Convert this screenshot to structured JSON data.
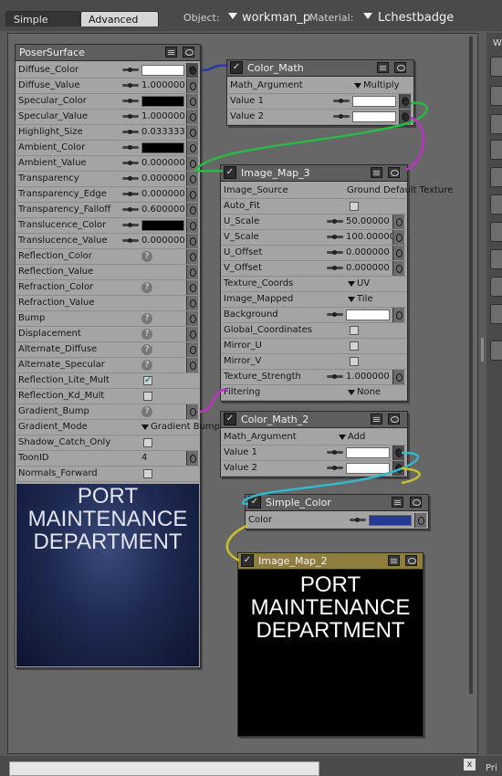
{
  "tabs": [
    "Simple",
    "Advanced"
  ],
  "object": {
    "label": "Object:",
    "value": "workman_p"
  },
  "material": {
    "label": "Material:",
    "value": "Lchestbadge"
  },
  "right_strip": {
    "label": "W"
  },
  "bottom": {
    "label": "Pri",
    "close": "x"
  },
  "colors": {
    "wire_blue": "#2a3aa0",
    "wire_green": "#2ab848",
    "wire_magenta": "#c030c8",
    "wire_cyan": "#34b8c8",
    "wire_yellow": "#c8c030",
    "simple_color_swatch": "#24389a"
  },
  "icons": {
    "node": "node-icon",
    "menu": "menu-icon",
    "eye": "eye-icon",
    "dial": "dial-icon",
    "plug": "input-plug-icon",
    "help": "help-icon",
    "checkbox": "checkbox-icon",
    "dropdown": "dropdown-arrow-icon"
  },
  "poser": {
    "title": "PoserSurface",
    "rows": {
      "diffuse_color": {
        "label": "Diffuse_Color",
        "swatch": "#ffffff"
      },
      "diffuse_value": {
        "label": "Diffuse_Value",
        "value": "1.000000"
      },
      "specular_color": {
        "label": "Specular_Color",
        "swatch": "#000000"
      },
      "specular_value": {
        "label": "Specular_Value",
        "value": "1.000000"
      },
      "highlight_size": {
        "label": "Highlight_Size",
        "value": "0.033333"
      },
      "ambient_color": {
        "label": "Ambient_Color",
        "swatch": "#000000"
      },
      "ambient_value": {
        "label": "Ambient_Value",
        "value": "0.000000"
      },
      "transparency": {
        "label": "Transparency",
        "value": "0.000000"
      },
      "transparency_edge": {
        "label": "Transparency_Edge",
        "value": "0.000000"
      },
      "transparency_falloff": {
        "label": "Transparency_Falloff",
        "value": "0.600000"
      },
      "translucence_color": {
        "label": "Translucence_Color",
        "swatch": "#000000"
      },
      "translucence_value": {
        "label": "Translucence_Value",
        "value": "0.000000"
      },
      "reflection_color": {
        "label": "Reflection_Color"
      },
      "reflection_value": {
        "label": "Reflection_Value"
      },
      "refraction_color": {
        "label": "Refraction_Color"
      },
      "refraction_value": {
        "label": "Refraction_Value"
      },
      "bump": {
        "label": "Bump"
      },
      "displacement": {
        "label": "Displacement"
      },
      "alternate_diffuse": {
        "label": "Alternate_Diffuse"
      },
      "alternate_specular": {
        "label": "Alternate_Specular"
      },
      "reflection_lite_mult": {
        "label": "Reflection_Lite_Mult",
        "checked": true
      },
      "reflection_kd_mult": {
        "label": "Reflection_Kd_Mult",
        "checked": false
      },
      "gradient_bump": {
        "label": "Gradient_Bump"
      },
      "gradient_mode": {
        "label": "Gradient_Mode",
        "value": "Gradient Bump"
      },
      "shadow_catch_only": {
        "label": "Shadow_Catch_Only",
        "checked": false
      },
      "toon_id": {
        "label": "ToonID",
        "value": "4"
      },
      "normals_forward": {
        "label": "Normals_Forward",
        "checked": false
      }
    },
    "preview_lines": [
      "PORT",
      "MAINTENANCE",
      "DEPARTMENT"
    ]
  },
  "color_math": {
    "title": "Color_Math",
    "math_argument": {
      "label": "Math_Argument",
      "value": "Multiply"
    },
    "value1": {
      "label": "Value 1",
      "swatch": "#ffffff"
    },
    "value2": {
      "label": "Value 2",
      "swatch": "#ffffff"
    }
  },
  "image_map_3": {
    "title": "Image_Map_3",
    "rows": {
      "image_source": {
        "label": "Image_Source",
        "value": "Ground Default Texture"
      },
      "auto_fit": {
        "label": "Auto_Fit",
        "checked": false
      },
      "u_scale": {
        "label": "U_Scale",
        "value": "50.00000"
      },
      "v_scale": {
        "label": "V_Scale",
        "value": "100.00000"
      },
      "u_offset": {
        "label": "U_Offset",
        "value": "0.000000"
      },
      "v_offset": {
        "label": "V_Offset",
        "value": "0.000000"
      },
      "texture_coords": {
        "label": "Texture_Coords",
        "value": "UV"
      },
      "image_mapped": {
        "label": "Image_Mapped",
        "value": "Tile"
      },
      "background": {
        "label": "Background",
        "swatch": "#ffffff"
      },
      "global_coordinates": {
        "label": "Global_Coordinates",
        "checked": false
      },
      "mirror_u": {
        "label": "Mirror_U",
        "checked": false
      },
      "mirror_v": {
        "label": "Mirror_V",
        "checked": false
      },
      "texture_strength": {
        "label": "Texture_Strength",
        "value": "1.000000"
      },
      "filtering": {
        "label": "Filtering",
        "value": "None"
      }
    }
  },
  "color_math_2": {
    "title": "Color_Math_2",
    "math_argument": {
      "label": "Math_Argument",
      "value": "Add"
    },
    "value1": {
      "label": "Value 1",
      "swatch": "#ffffff"
    },
    "value2": {
      "label": "Value 2",
      "swatch": "#ffffff"
    }
  },
  "simple_color": {
    "title": "Simple_Color",
    "color": {
      "label": "Color",
      "swatch": "#24389a"
    }
  },
  "image_map_2": {
    "title": "Image_Map_2",
    "preview_lines": [
      "PORT",
      "MAINTENANCE",
      "DEPARTMENT"
    ]
  }
}
